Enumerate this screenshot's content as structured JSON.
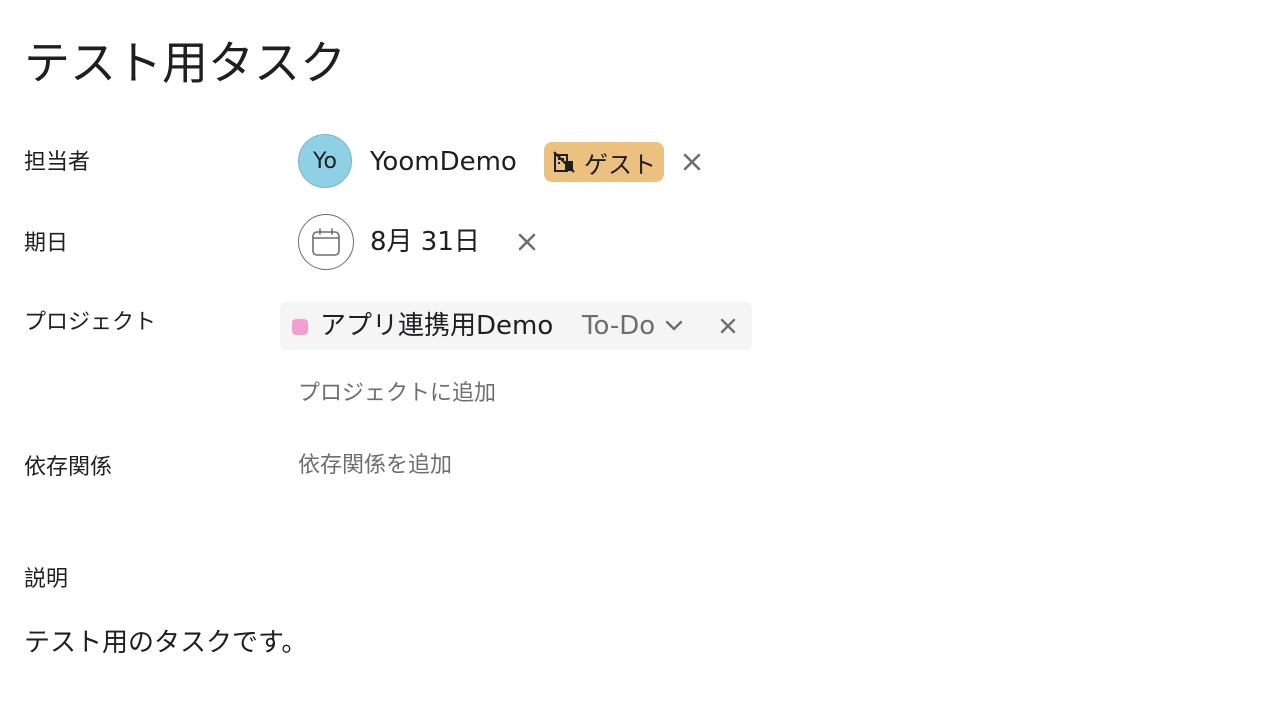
{
  "task": {
    "title": "テスト用タスク"
  },
  "fields": {
    "assignee_label": "担当者",
    "due_label": "期日",
    "project_label": "プロジェクト",
    "dependency_label": "依存関係",
    "description_label": "説明"
  },
  "assignee": {
    "initials": "Yo",
    "name": "YoomDemo",
    "badge": "ゲスト",
    "avatar_color": "#8fd0e4",
    "badge_color": "#ecc07f",
    "badge_icon": "guest-building-icon",
    "remove_icon": "close-icon"
  },
  "due_date": {
    "value": "8月 31日",
    "icon": "calendar-icon",
    "remove_icon": "close-icon"
  },
  "project": {
    "name": "アプリ連携用Demo",
    "section": "To-Do",
    "color": "#f29fcf",
    "chevron_icon": "chevron-down-icon",
    "remove_icon": "close-icon",
    "add_label": "プロジェクトに追加"
  },
  "dependencies": {
    "add_label": "依存関係を追加"
  },
  "description": {
    "text": "テスト用のタスクです。"
  }
}
